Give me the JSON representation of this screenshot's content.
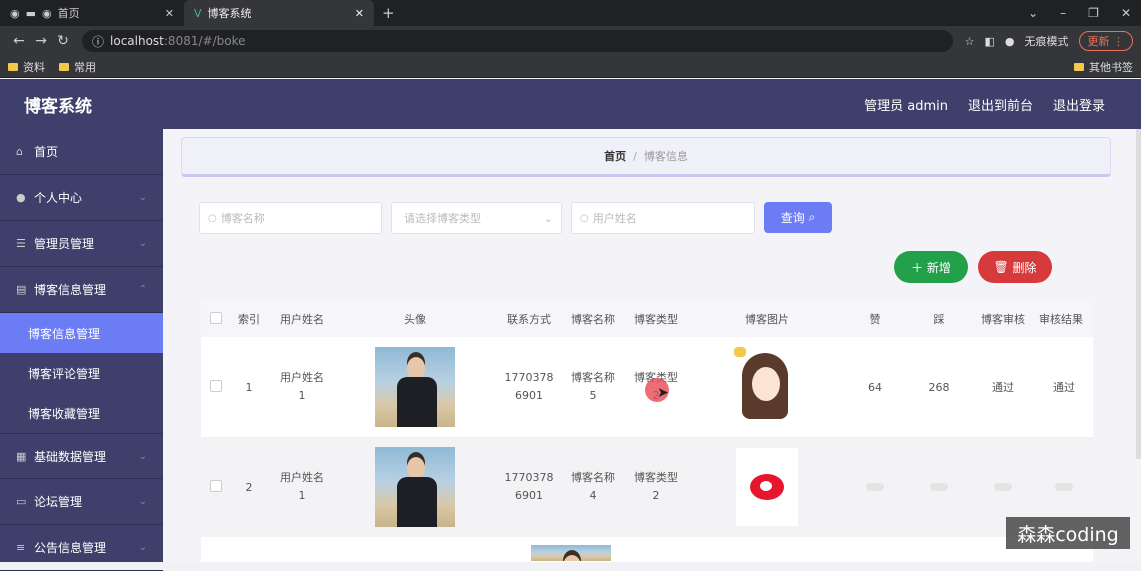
{
  "browser": {
    "tabs": [
      {
        "title": "首页"
      },
      {
        "title": "博客系统"
      }
    ],
    "url_host": "localhost",
    "url_rest": ":8081/#/boke",
    "incognito": "无痕模式",
    "update": "更新",
    "bookmarks": [
      "资料",
      "常用"
    ],
    "bookmarks_other": "其他书签"
  },
  "header": {
    "brand": "博客系统",
    "nav": [
      "管理员 admin",
      "退出到前台",
      "退出登录"
    ]
  },
  "sidebar": {
    "items": [
      {
        "label": "首页",
        "icon": "home-icon"
      },
      {
        "label": "个人中心",
        "icon": "user-icon"
      },
      {
        "label": "管理员管理",
        "icon": "settings-icon"
      },
      {
        "label": "博客信息管理",
        "icon": "clipboard-icon"
      },
      {
        "label": "基础数据管理",
        "icon": "grid-icon"
      },
      {
        "label": "论坛管理",
        "icon": "chat-icon"
      },
      {
        "label": "公告信息管理",
        "icon": "list-icon"
      }
    ],
    "sub_items": [
      "博客信息管理",
      "博客评论管理",
      "博客收藏管理"
    ]
  },
  "breadcrumb": {
    "home": "首页",
    "sep": "/",
    "current": "博客信息"
  },
  "search": {
    "name_placeholder": "博客名称",
    "type_placeholder": "请选择博客类型",
    "user_placeholder": "用户姓名",
    "query_label": "查询"
  },
  "actions": {
    "add_label": "新增",
    "delete_label": "删除"
  },
  "table": {
    "columns": [
      "索引",
      "用户姓名",
      "头像",
      "联系方式",
      "博客名称",
      "博客类型",
      "博客图片",
      "赞",
      "踩",
      "博客审核",
      "审核结果"
    ],
    "rows": [
      {
        "index": "1",
        "user": "用户姓名\n1",
        "phone": "1770378\n6901",
        "name": "博客名称\n5",
        "type": "博客类型\n2",
        "zan": "64",
        "cai": "268",
        "audit": "通过",
        "result": "通过"
      },
      {
        "index": "2",
        "user": "用户姓名\n1",
        "phone": "1770378\n6901",
        "name": "博客名称\n4",
        "type": "博客类型\n2"
      }
    ]
  },
  "watermark": "森森coding"
}
